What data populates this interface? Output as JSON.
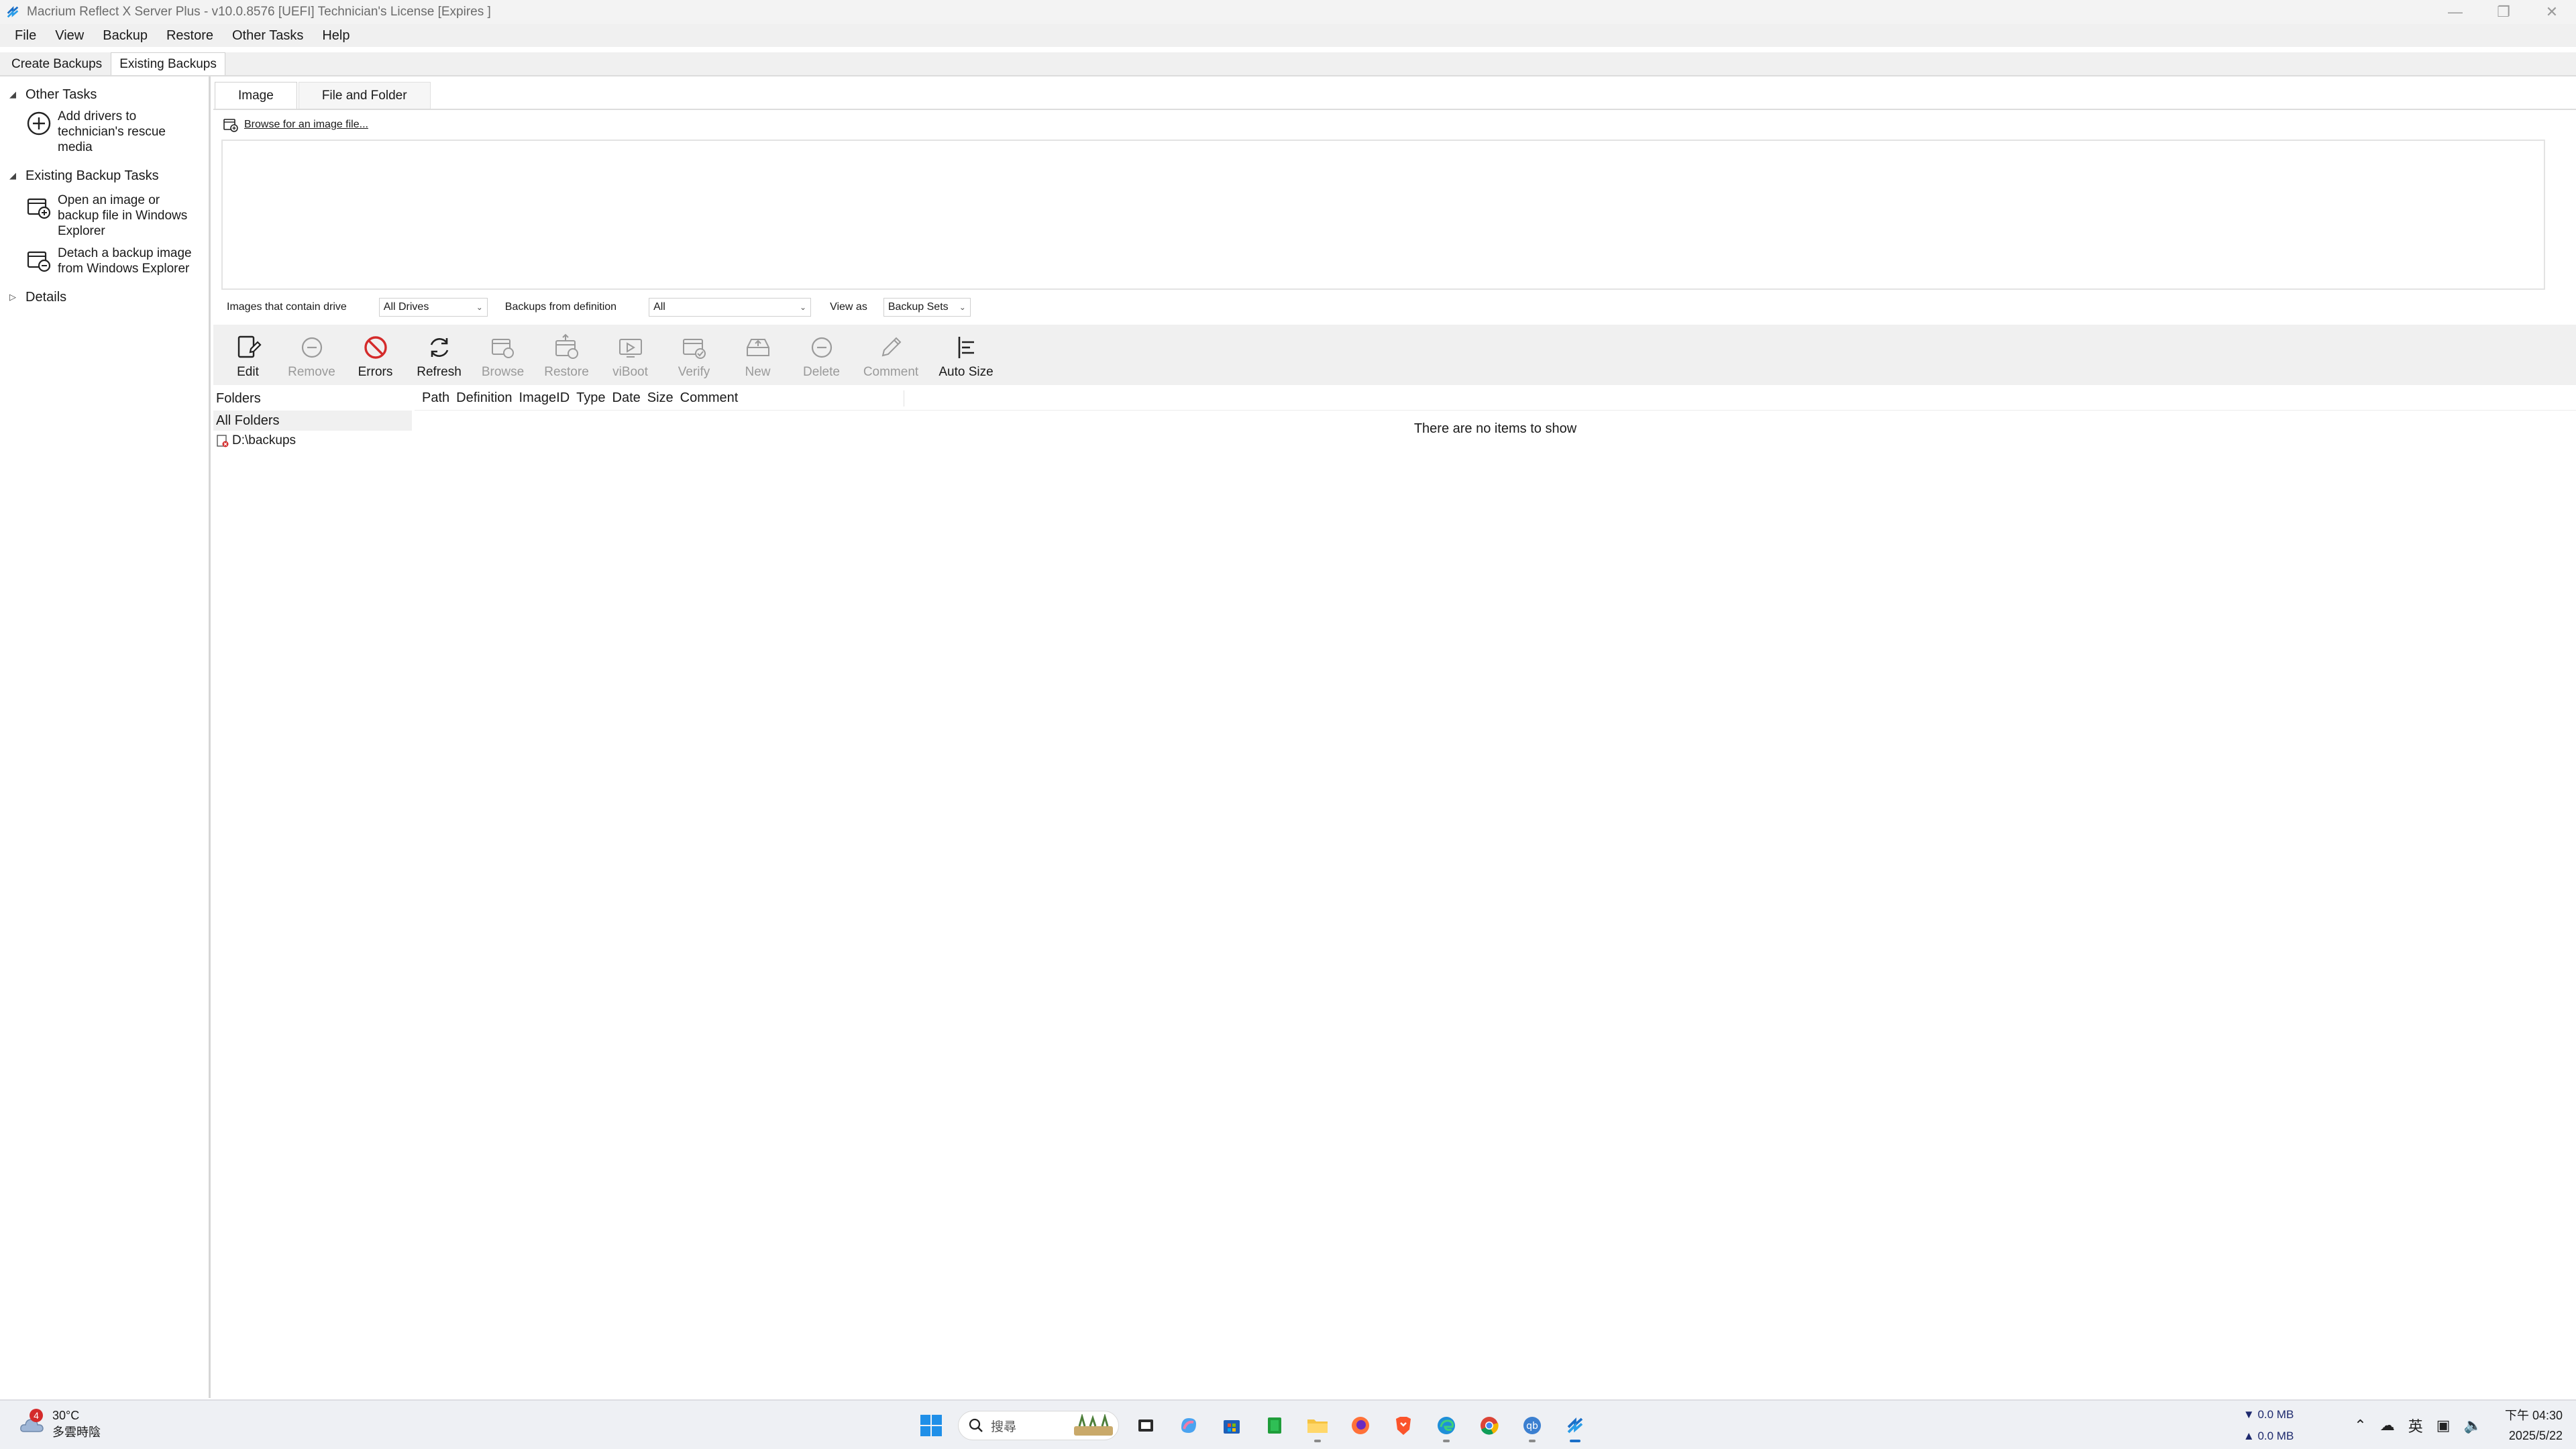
{
  "window": {
    "title": "Macrium Reflect X Server Plus - v10.0.8576  [UEFI] Technician's License [Expires ]",
    "controls": [
      "minimize",
      "restore",
      "close"
    ]
  },
  "menu": [
    "File",
    "View",
    "Backup",
    "Restore",
    "Other Tasks",
    "Help"
  ],
  "main_tabs": [
    {
      "label": "Create Backups",
      "active": false
    },
    {
      "label": "Existing Backups",
      "active": true
    }
  ],
  "sidebar": {
    "groups": [
      {
        "title": "Other Tasks",
        "expanded": true,
        "items": [
          {
            "label": "Add drivers to technician's rescue media",
            "icon": "add-circle-icon"
          }
        ]
      },
      {
        "title": "Existing Backup Tasks",
        "expanded": true,
        "items": [
          {
            "label": "Open an image or backup file in Windows Explorer",
            "icon": "open-image-icon"
          },
          {
            "label": "Detach a backup image from Windows Explorer",
            "icon": "detach-image-icon"
          }
        ]
      },
      {
        "title": "Details",
        "expanded": false,
        "items": []
      }
    ]
  },
  "content": {
    "sub_tabs": [
      {
        "label": "Image",
        "active": true
      },
      {
        "label": "File and Folder",
        "active": false
      }
    ],
    "browse_link": "Browse for an image file...",
    "filters": {
      "drive_label": "Images that contain drive",
      "drive_value": "All Drives",
      "definition_label": "Backups from definition",
      "definition_value": "All",
      "view_label": "View as",
      "view_value": "Backup Sets"
    },
    "toolbar": [
      {
        "label": "Edit",
        "icon": "edit-icon",
        "enabled": true
      },
      {
        "label": "Remove",
        "icon": "remove-icon",
        "enabled": false
      },
      {
        "label": "Errors",
        "icon": "errors-icon",
        "enabled": true
      },
      {
        "label": "Refresh",
        "icon": "refresh-icon",
        "enabled": true
      },
      {
        "label": "Browse",
        "icon": "browse-icon",
        "enabled": false
      },
      {
        "label": "Restore",
        "icon": "restore-icon",
        "enabled": false
      },
      {
        "label": "viBoot",
        "icon": "viboot-icon",
        "enabled": false
      },
      {
        "label": "Verify",
        "icon": "verify-icon",
        "enabled": false
      },
      {
        "label": "New",
        "icon": "new-icon",
        "enabled": false
      },
      {
        "label": "Delete",
        "icon": "delete-icon",
        "enabled": false
      },
      {
        "label": "Comment",
        "icon": "comment-icon",
        "enabled": false
      },
      {
        "label": "Auto Size",
        "icon": "auto-size-icon",
        "enabled": true
      }
    ],
    "folders": {
      "header": "Folders",
      "all": "All Folders",
      "items": [
        "D:\\backups"
      ]
    },
    "list": {
      "columns": [
        "Path",
        "Definition",
        "ImageID",
        "Type",
        "Date",
        "Size",
        "Comment"
      ],
      "empty_text": "There are no items to show"
    }
  },
  "taskbar": {
    "weather": {
      "badge": "4",
      "temp": "30°C",
      "desc": "多雲時陰"
    },
    "search_placeholder": "搜尋",
    "net_down": "▼ 0.0 MB",
    "net_up": "▲ 0.0 MB",
    "ime": "英",
    "time": "下午 04:30",
    "date": "2025/5/22"
  },
  "colors": {
    "accent": "#0067c0",
    "error_red": "#d42b2b",
    "disabled_gray": "#9a9a9a"
  }
}
